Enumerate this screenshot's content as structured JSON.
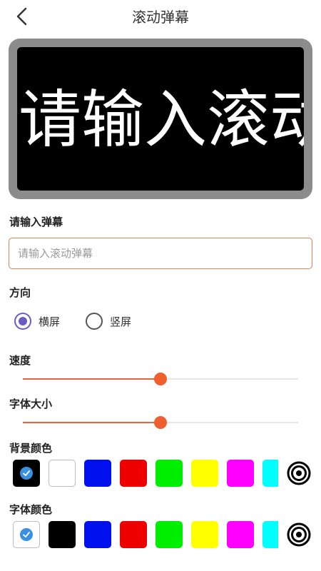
{
  "header": {
    "title": "滚动弹幕",
    "back_icon": "chevron-left-icon"
  },
  "preview": {
    "text": "请输入滚动弹幕",
    "background_color": "#000000",
    "text_color": "#ffffff"
  },
  "input_section": {
    "label": "请输入弹幕",
    "placeholder": "请输入滚动弹幕",
    "value": ""
  },
  "direction": {
    "label": "方向",
    "options": [
      {
        "label": "横屏",
        "selected": true
      },
      {
        "label": "竖屏",
        "selected": false
      }
    ]
  },
  "speed": {
    "label": "速度",
    "value_fraction": 0.5
  },
  "font_size": {
    "label": "字体大小",
    "value_fraction": 0.5
  },
  "background_color": {
    "label": "背景颜色",
    "swatches": [
      "#000000",
      "#ffffff",
      "#0011ee",
      "#ee0000",
      "#00ee00",
      "#ffff00",
      "#ff00ff",
      "#00ffff"
    ],
    "selected_index": 0,
    "picker_icon": "color-picker-target-icon"
  },
  "font_color": {
    "label": "字体颜色",
    "swatches": [
      "#ffffff",
      "#000000",
      "#0011ee",
      "#ee0000",
      "#00ee00",
      "#ffff00",
      "#ff00ff",
      "#00ffff"
    ],
    "selected_index": 0,
    "picker_icon": "color-picker-target-icon"
  },
  "accent_colors": {
    "input_border": "#e57e55",
    "slider": "#ef5f2f",
    "radio": "#6b5cc4",
    "check": "#3a8fe0"
  }
}
